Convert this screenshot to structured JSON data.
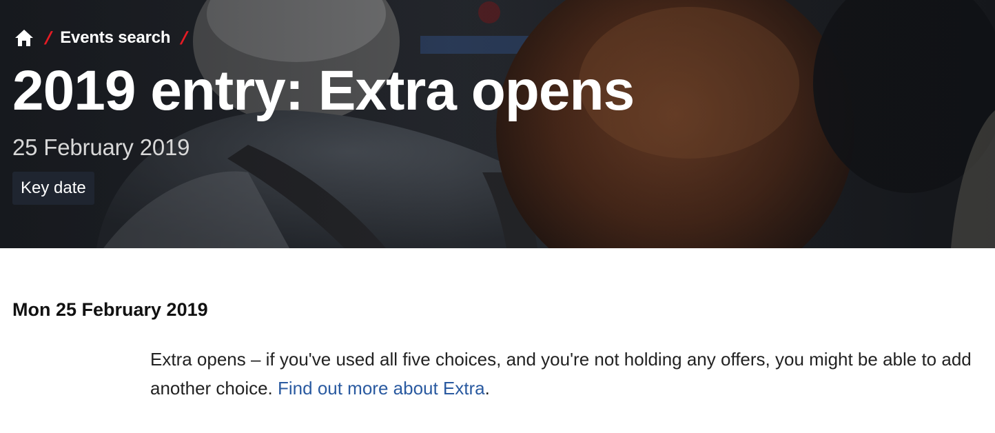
{
  "breadcrumb": {
    "home_icon": "home-icon",
    "separator": "/",
    "items": [
      {
        "label": "Events search"
      }
    ]
  },
  "hero": {
    "title": "2019 entry: Extra opens",
    "date": "25 February 2019",
    "badge": "Key date"
  },
  "main": {
    "day_heading": "Mon 25 February 2019",
    "description_text": "Extra opens – if you've used all five choices, and you're not holding any offers, you might be able to add another choice. ",
    "description_link": "Find out more about Extra",
    "description_end": "."
  },
  "colors": {
    "accent_red": "#e51b24",
    "badge_bg": "#1f2530",
    "link_blue": "#2a5aa0"
  }
}
